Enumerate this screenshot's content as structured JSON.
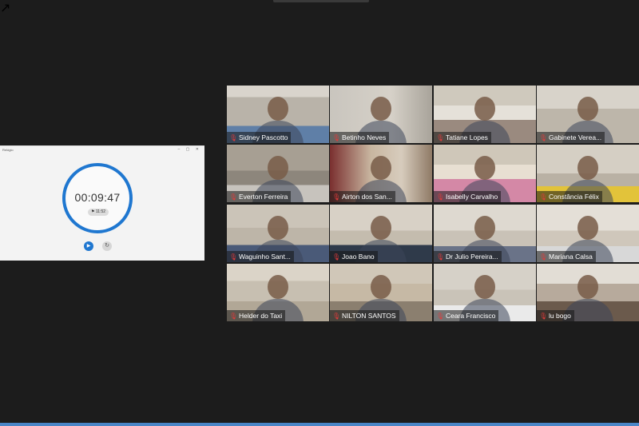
{
  "shared_screen": {
    "app_title": "Relógio",
    "window_controls": "– ▢ ✕",
    "pin_icon": "↗",
    "stopwatch": {
      "time": "00:09:47",
      "lap_time": "11:52",
      "lap_icon": "flag-icon",
      "play_icon": "play-icon",
      "reset_icon": "reset-icon"
    },
    "accent_color": "#1f77d0"
  },
  "participants": [
    {
      "name": "Sidney Pascotto"
    },
    {
      "name": "Betinho Neves"
    },
    {
      "name": "Tatiane Lopes"
    },
    {
      "name": "Gabinete Verea..."
    },
    {
      "name": "Everton Ferreira"
    },
    {
      "name": "Airton dos San..."
    },
    {
      "name": "Isabelly Carvalho"
    },
    {
      "name": "Constância Félix",
      "active": true
    },
    {
      "name": "Waguinho Sant..."
    },
    {
      "name": "Joao Bano"
    },
    {
      "name": "Dr Julio Pereira..."
    },
    {
      "name": "Mariana Calsa"
    },
    {
      "name": "Helder do Taxi"
    },
    {
      "name": "NILTON SANTOS"
    },
    {
      "name": "Ceara Francisco"
    },
    {
      "name": "lu bogo"
    }
  ],
  "mic_muted_icon": "mic-muted-icon",
  "colors": {
    "background": "#1c1c1c",
    "active_speaker": "#c8e64a",
    "mute_red": "#e23a3a"
  }
}
